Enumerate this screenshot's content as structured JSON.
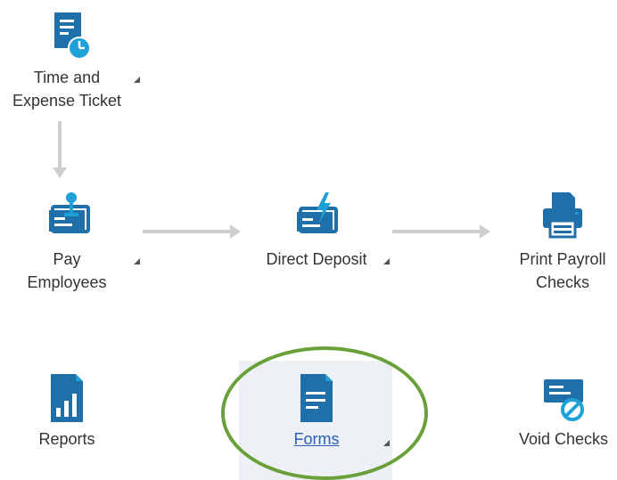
{
  "colors": {
    "icon_blue": "#1f6fa8",
    "icon_accent": "#1ea0d8",
    "arrow_gray": "#cfcfcf",
    "highlight_green": "#6aa039",
    "link_blue": "#2d5fb7",
    "selected_bg": "#edf0f4"
  },
  "nodes": {
    "time_expense": {
      "label": "Time and\nExpense  Ticket",
      "icon": "timesheet-clock-icon"
    },
    "pay_employees": {
      "label": "Pay\nEmployees",
      "icon": "paycheck-stamp-icon"
    },
    "direct_deposit": {
      "label": "Direct Deposit",
      "icon": "check-lightning-icon"
    },
    "print_payroll": {
      "label": "Print Payroll\nChecks",
      "icon": "printer-icon"
    },
    "reports": {
      "label": "Reports",
      "icon": "bar-chart-document-icon"
    },
    "forms": {
      "label": "Forms",
      "icon": "form-document-icon"
    },
    "void_checks": {
      "label": "Void Checks",
      "icon": "check-void-icon"
    }
  }
}
